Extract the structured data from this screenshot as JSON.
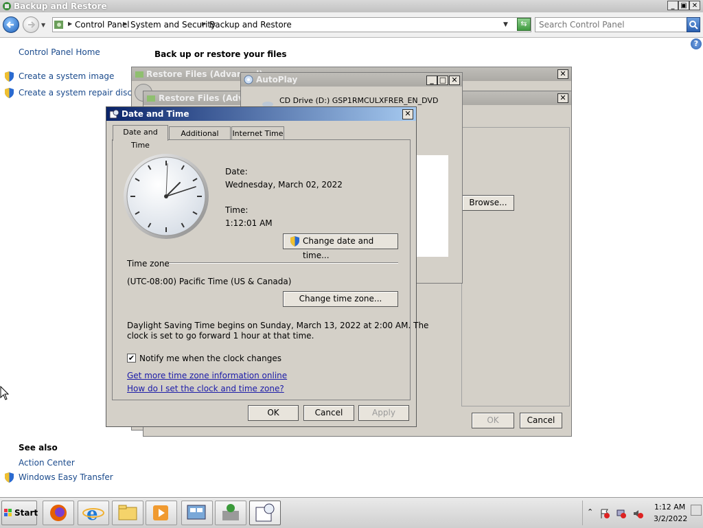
{
  "window": {
    "title": "Backup and Restore"
  },
  "address": {
    "crumbs": [
      "Control Panel",
      "System and Security",
      "Backup and Restore"
    ],
    "search_placeholder": "Search Control Panel"
  },
  "sidebar": {
    "home": "Control Panel Home",
    "links": [
      "Create a system image",
      "Create a system repair disc"
    ],
    "see_also_title": "See also",
    "see_also": [
      "Action Center",
      "Windows Easy Transfer"
    ]
  },
  "main": {
    "heading": "Back up or restore your files"
  },
  "restore1": {
    "title": "Restore Files (Advanced)",
    "subtitle": "Restore Files (Advanced)"
  },
  "restore2": {
    "title": "Restore Files (Advanced)",
    "browse": "Browse...",
    "ok": "OK",
    "cancel": "Cancel"
  },
  "autoplay": {
    "title": "AutoPlay",
    "drive": "CD Drive (D:) GSP1RMCULXFRER_EN_DVD"
  },
  "datetime": {
    "title": "Date and Time",
    "tabs": [
      "Date and Time",
      "Additional Clocks",
      "Internet Time"
    ],
    "date_label": "Date:",
    "date_value": "Wednesday, March 02, 2022",
    "time_label": "Time:",
    "time_value": "1:12:01 AM",
    "change_date_button": "Change date and time...",
    "timezone_label": "Time zone",
    "timezone_value": "(UTC-08:00) Pacific Time (US & Canada)",
    "change_tz_button": "Change time zone...",
    "dst_line1": "Daylight Saving Time begins on Sunday, March 13, 2022 at 2:00 AM. The",
    "dst_line2": "clock is set to go forward 1 hour at that time.",
    "notify_label": "Notify me when the clock changes",
    "notify_checked": true,
    "link1": "Get more time zone information online",
    "link2": "How do I set the clock and time zone?",
    "ok": "OK",
    "cancel": "Cancel",
    "apply": "Apply"
  },
  "taskbar": {
    "start": "Start",
    "apps": [
      "firefox-icon",
      "internet-explorer-icon",
      "file-explorer-icon",
      "media-player-icon",
      "server-manager-icon",
      "backup-icon",
      "date-time-icon"
    ],
    "clock_time": "1:12 AM",
    "clock_date": "3/2/2022"
  }
}
